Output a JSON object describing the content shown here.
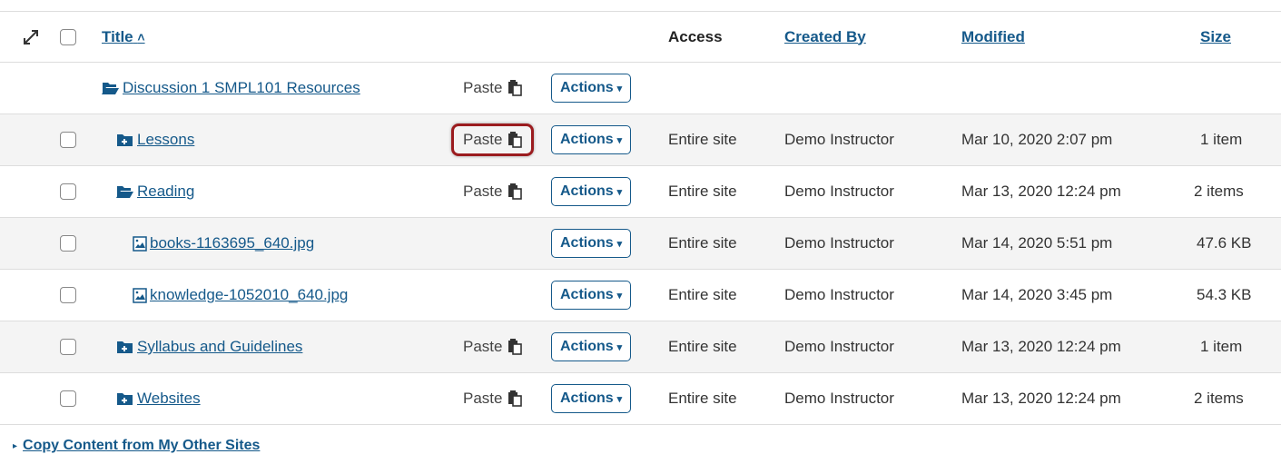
{
  "header": {
    "title": "Title",
    "access": "Access",
    "created_by": "Created By",
    "modified": "Modified",
    "size": "Size"
  },
  "paste_label": "Paste",
  "actions_label": "Actions",
  "parent": {
    "name": "Discussion 1 SMPL101 Resources"
  },
  "rows": [
    {
      "name": "Lessons",
      "access": "Entire site",
      "created_by": "Demo Instructor",
      "modified": "Mar 10, 2020 2:07 pm",
      "size": "1 item"
    },
    {
      "name": "Reading",
      "access": "Entire site",
      "created_by": "Demo Instructor",
      "modified": "Mar 13, 2020 12:24 pm",
      "size": "2 items"
    },
    {
      "name": "books-1163695_640.jpg",
      "access": "Entire site",
      "created_by": "Demo Instructor",
      "modified": "Mar 14, 2020 5:51 pm",
      "size": "47.6 KB"
    },
    {
      "name": "knowledge-1052010_640.jpg",
      "access": "Entire site",
      "created_by": "Demo Instructor",
      "modified": "Mar 14, 2020 3:45 pm",
      "size": "54.3 KB"
    },
    {
      "name": "Syllabus and Guidelines",
      "access": "Entire site",
      "created_by": "Demo Instructor",
      "modified": "Mar 13, 2020 12:24 pm",
      "size": "1 item"
    },
    {
      "name": "Websites",
      "access": "Entire site",
      "created_by": "Demo Instructor",
      "modified": "Mar 13, 2020 12:24 pm",
      "size": "2 items"
    }
  ],
  "footer": {
    "copy_link": "Copy Content from My Other Sites"
  }
}
